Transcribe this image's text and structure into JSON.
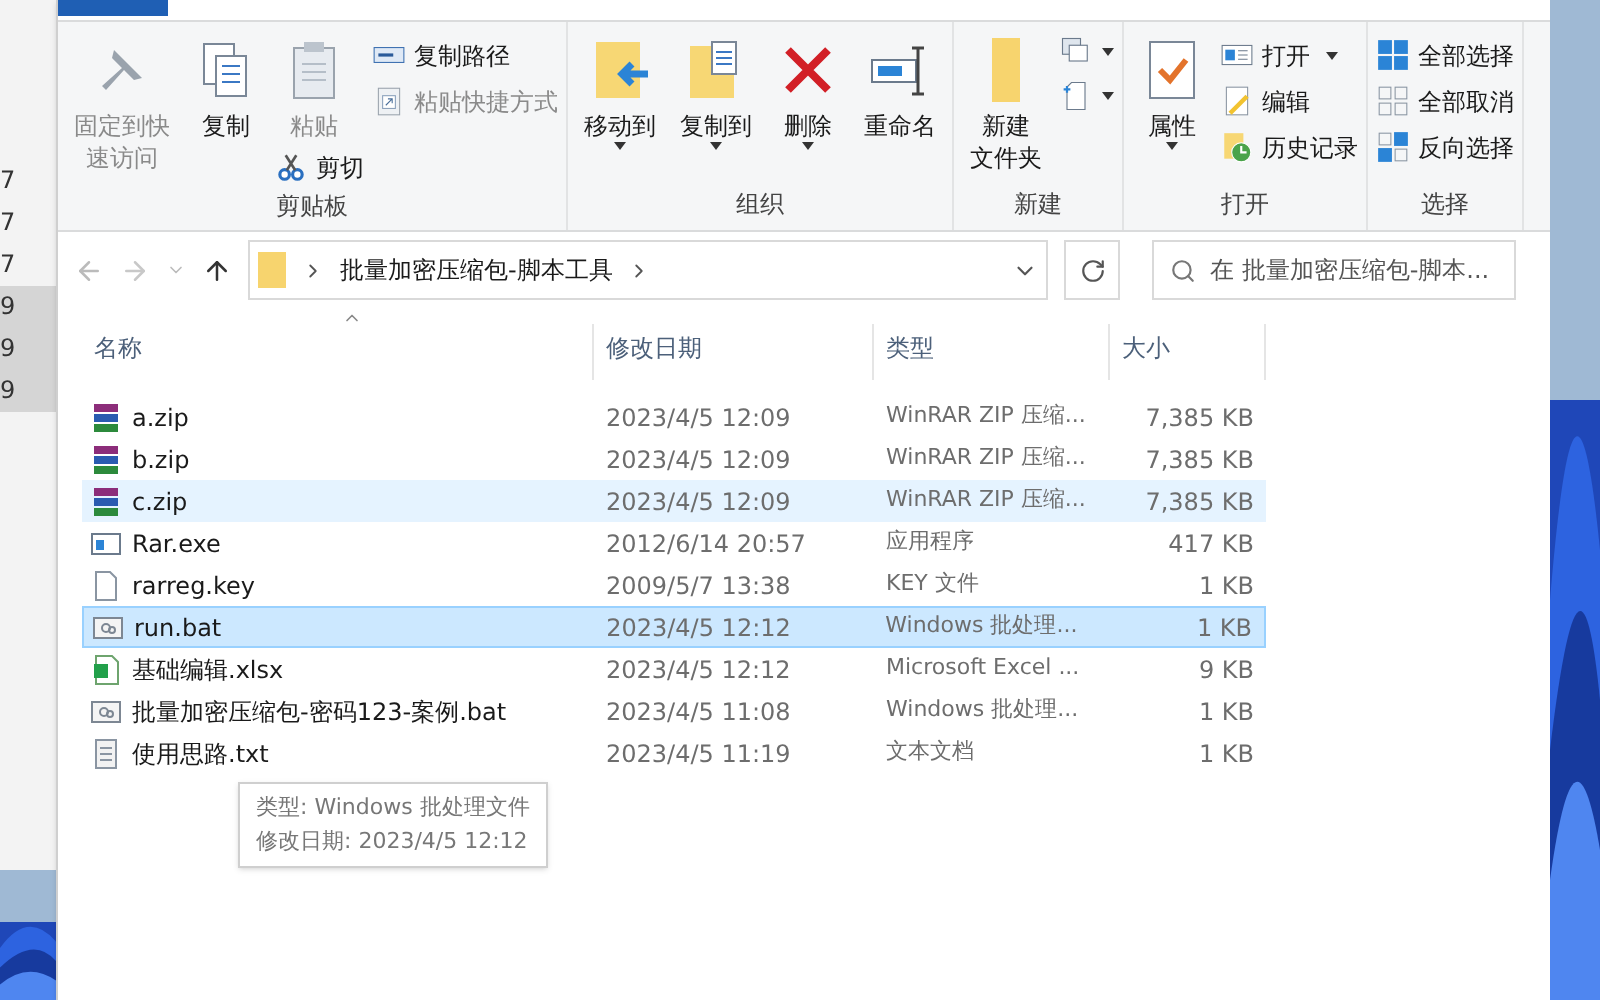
{
  "background_window": {
    "items": [
      {
        "label": "7",
        "highlighted": false
      },
      {
        "label": "7",
        "highlighted": false
      },
      {
        "label": "7",
        "highlighted": false
      },
      {
        "label": "9",
        "highlighted": true
      },
      {
        "label": "9",
        "highlighted": true
      },
      {
        "label": "9",
        "highlighted": true
      }
    ]
  },
  "ribbon": {
    "groups": [
      {
        "label": "剪贴板",
        "columns": [
          [
            {
              "kind": "large",
              "lines": [
                "固定到快",
                "速访问"
              ],
              "disabled": true,
              "dropdown": false
            }
          ],
          [
            {
              "kind": "large",
              "label": "复制",
              "disabled": false,
              "dropdown": false
            }
          ],
          [
            {
              "kind": "large",
              "label": "粘贴",
              "disabled": true,
              "dropdown": false
            },
            {
              "kind": "small",
              "label": "剪切",
              "disabled": false,
              "dropdown": false
            }
          ],
          [
            {
              "kind": "small",
              "label": "复制路径",
              "disabled": false,
              "dropdown": false
            },
            {
              "kind": "small",
              "label": "粘贴快捷方式",
              "disabled": true,
              "dropdown": false
            }
          ]
        ]
      },
      {
        "label": "组织",
        "columns": [
          [
            {
              "kind": "large",
              "label": "移动到",
              "disabled": false,
              "dropdown": true
            }
          ],
          [
            {
              "kind": "large",
              "label": "复制到",
              "disabled": false,
              "dropdown": true
            }
          ],
          [
            {
              "kind": "large",
              "label": "删除",
              "disabled": false,
              "dropdown": true
            }
          ],
          [
            {
              "kind": "large",
              "label": "重命名",
              "disabled": false,
              "dropdown": false
            }
          ]
        ]
      },
      {
        "label": "新建",
        "columns": [
          [
            {
              "kind": "large",
              "lines": [
                "新建",
                "文件夹"
              ],
              "disabled": false,
              "dropdown": false
            }
          ],
          [
            {
              "kind": "icon",
              "disabled": false,
              "dropdown": true
            },
            {
              "kind": "icon",
              "disabled": false,
              "dropdown": true
            }
          ]
        ]
      },
      {
        "label": "打开",
        "columns": [
          [
            {
              "kind": "large",
              "label": "属性",
              "disabled": false,
              "dropdown": true
            }
          ],
          [
            {
              "kind": "small",
              "label": "打开",
              "disabled": false,
              "dropdown": true
            },
            {
              "kind": "small",
              "label": "编辑",
              "disabled": false,
              "dropdown": false
            },
            {
              "kind": "small",
              "label": "历史记录",
              "disabled": false,
              "dropdown": false
            }
          ]
        ]
      },
      {
        "label": "选择",
        "columns": [
          [
            {
              "kind": "small",
              "label": "全部选择",
              "disabled": false,
              "dropdown": false
            },
            {
              "kind": "small",
              "label": "全部取消",
              "disabled": false,
              "dropdown": false
            },
            {
              "kind": "small",
              "label": "反向选择",
              "disabled": false,
              "dropdown": false
            }
          ]
        ]
      }
    ]
  },
  "address_bar": {
    "path": "批量加密压缩包-脚本工具",
    "back_disabled": false,
    "forward_disabled": true
  },
  "search": {
    "placeholder": "在 批量加密压缩包-脚本..."
  },
  "table": {
    "columns": [
      "名称",
      "修改日期",
      "类型",
      "大小"
    ],
    "rows": [
      {
        "kind": "zip",
        "name": "a.zip",
        "date": "2023/4/5 12:09",
        "type": "WinRAR ZIP 压缩...",
        "size": "7,385 KB",
        "selected": false,
        "hovered": false
      },
      {
        "kind": "zip",
        "name": "b.zip",
        "date": "2023/4/5 12:09",
        "type": "WinRAR ZIP 压缩...",
        "size": "7,385 KB",
        "selected": false,
        "hovered": false
      },
      {
        "kind": "zip",
        "name": "c.zip",
        "date": "2023/4/5 12:09",
        "type": "WinRAR ZIP 压缩...",
        "size": "7,385 KB",
        "selected": false,
        "hovered": true
      },
      {
        "kind": "exe",
        "name": "Rar.exe",
        "date": "2012/6/14 20:57",
        "type": "应用程序",
        "size": "417 KB",
        "selected": false,
        "hovered": false
      },
      {
        "kind": "key",
        "name": "rarreg.key",
        "date": "2009/5/7 13:38",
        "type": "KEY 文件",
        "size": "1 KB",
        "selected": false,
        "hovered": false
      },
      {
        "kind": "bat",
        "name": "run.bat",
        "date": "2023/4/5 12:12",
        "type": "Windows 批处理...",
        "size": "1 KB",
        "selected": true,
        "hovered": false
      },
      {
        "kind": "xlsx",
        "name": "基础编辑.xlsx",
        "date": "2023/4/5 12:12",
        "type": "Microsoft Excel ...",
        "size": "9 KB",
        "selected": false,
        "hovered": false
      },
      {
        "kind": "bat",
        "name": "批量加密压缩包-密码123-案例.bat",
        "date": "2023/4/5 11:08",
        "type": "Windows 批处理...",
        "size": "1 KB",
        "selected": false,
        "hovered": false
      },
      {
        "kind": "txt",
        "name": "使用思路.txt",
        "date": "2023/4/5 11:19",
        "type": "文本文档",
        "size": "1 KB",
        "selected": false,
        "hovered": false
      }
    ]
  },
  "tooltip": {
    "lines": [
      "类型: Windows 批处理文件",
      "修改日期: 2023/4/5 12:12"
    ]
  }
}
